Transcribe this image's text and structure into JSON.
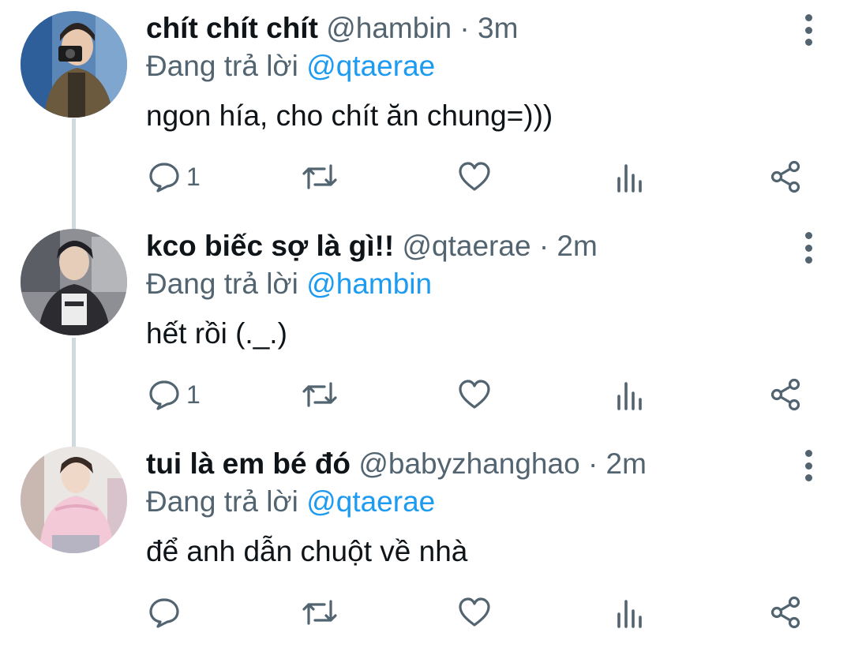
{
  "replying_prefix": "Đang trả lời",
  "tweets": [
    {
      "name": "chít chít chít",
      "handle": "@hambin",
      "time": "· 3m",
      "reply_to": "@qtaerae",
      "text": "ngon hía, cho chít ăn chung=)))",
      "reply_count": "1"
    },
    {
      "name": "kco biếc sợ là gì!!",
      "handle": "@qtaerae",
      "time": "· 2m",
      "reply_to": "@hambin",
      "text": "hết rồi (._.)",
      "reply_count": "1"
    },
    {
      "name": "tui là em bé đó",
      "handle": "@babyzhanghao",
      "time": "· 2m",
      "reply_to": "@qtaerae",
      "text": "để anh dẫn chuột về nhà",
      "reply_count": ""
    }
  ],
  "icons": [
    "reply-icon",
    "retweet-icon",
    "like-icon",
    "analytics-icon",
    "share-icon",
    "more-options-icon"
  ],
  "colors": {
    "name": "#0f1419",
    "muted": "#536471",
    "mention": "#1d9bf0",
    "thread_line": "#cfd9de"
  }
}
